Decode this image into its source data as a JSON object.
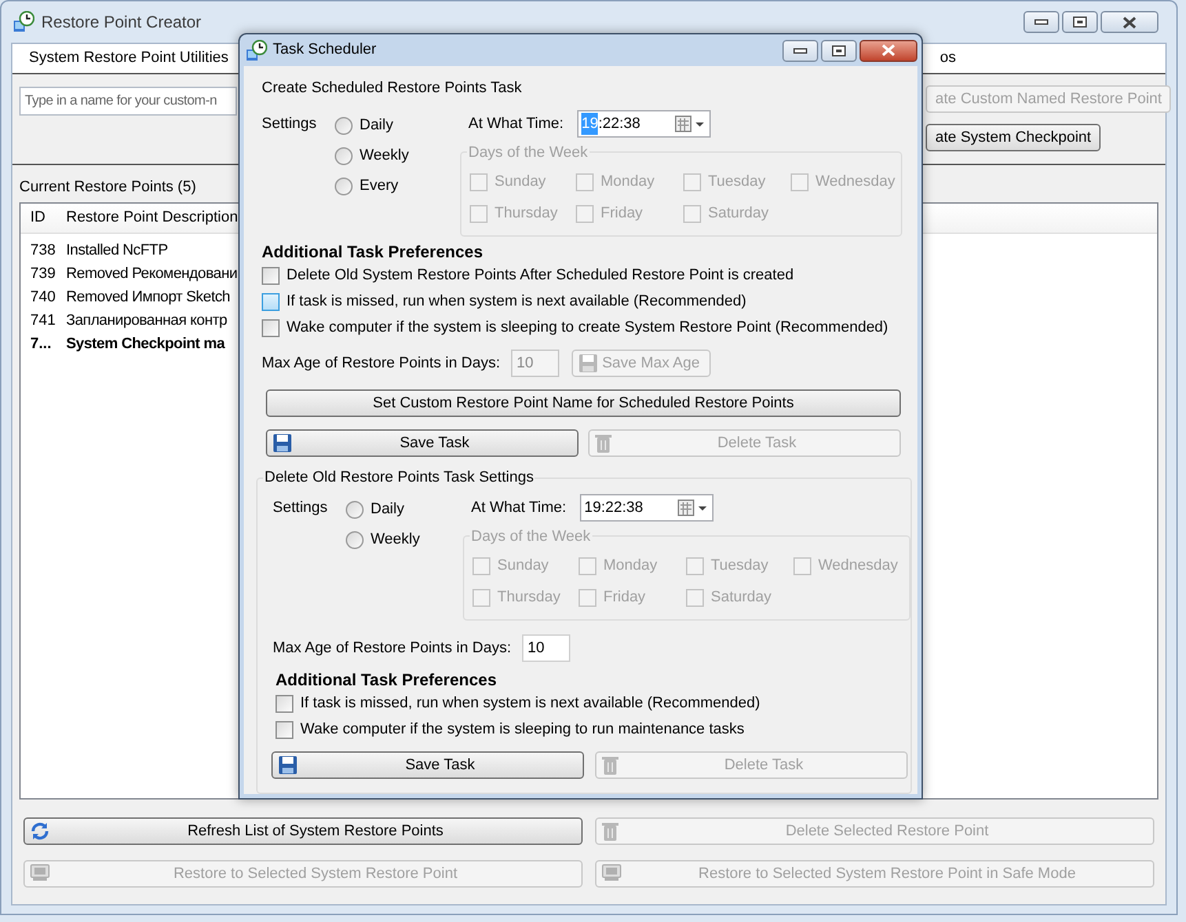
{
  "main_window": {
    "title": "Restore Point Creator",
    "menu": [
      {
        "label": "System Restore Point Utilities"
      },
      {
        "label": "os"
      }
    ],
    "name_field": {
      "placeholder": "Type in a name for your custom-n"
    },
    "right_buttons": [
      {
        "label": "ate Custom Named Restore Point",
        "disabled": true
      },
      {
        "label": "ate System Checkpoint",
        "disabled": false
      }
    ],
    "restore_points": {
      "title": "Current Restore Points (5)",
      "columns": [
        "ID",
        "Restore Point Description"
      ],
      "rows": [
        {
          "id": "738",
          "description": "Installed NcFTP",
          "emphasized": false
        },
        {
          "id": "739",
          "description": "Removed Рекомендовани",
          "emphasized": false
        },
        {
          "id": "740",
          "description": "Removed Импорт Sketch",
          "emphasized": false
        },
        {
          "id": "741",
          "description": "Запланированная контр",
          "emphasized": false
        },
        {
          "id": "7...",
          "description": "System Checkpoint ma",
          "emphasized": true
        }
      ]
    },
    "bottom_buttons": [
      {
        "label": "Refresh List of System Restore Points",
        "kind": "refresh",
        "disabled": false
      },
      {
        "label": "Delete Selected Restore Point",
        "kind": "trash",
        "disabled": true
      },
      {
        "label": "Restore to Selected System Restore Point",
        "kind": "drive",
        "disabled": true
      },
      {
        "label": "Restore to Selected System Restore Point in Safe Mode",
        "kind": "drive",
        "disabled": true
      }
    ]
  },
  "dialog": {
    "title": "Task Scheduler",
    "schedule": {
      "heading": "Create Scheduled Restore Points Task",
      "settings_label": "Settings",
      "options": [
        {
          "label": "Daily",
          "selected": false
        },
        {
          "label": "Weekly",
          "selected": false
        },
        {
          "label": "Every",
          "selected": false
        }
      ],
      "time_label": "At What Time:",
      "time_selected_part": "19",
      "time_rest": ":22:38",
      "days_title": "Days of the Week",
      "days": [
        {
          "label": "Sunday",
          "checked": false,
          "disabled": true
        },
        {
          "label": "Monday",
          "checked": false,
          "disabled": true
        },
        {
          "label": "Tuesday",
          "checked": false,
          "disabled": true
        },
        {
          "label": "Wednesday",
          "checked": false,
          "disabled": true
        },
        {
          "label": "Thursday",
          "checked": false,
          "disabled": true
        },
        {
          "label": "Friday",
          "checked": false,
          "disabled": true
        },
        {
          "label": "Saturday",
          "checked": false,
          "disabled": true
        }
      ],
      "prefs_title": "Additional Task Preferences",
      "prefs": [
        {
          "label": "Delete Old System Restore Points After Scheduled Restore Point is created",
          "checked": false,
          "hovered": false
        },
        {
          "label": "If task is missed, run when system is next available (Recommended)",
          "checked": false,
          "hovered": true
        },
        {
          "label": "Wake computer if the system is sleeping to create System Restore Point (Recommended)",
          "checked": false,
          "hovered": false
        }
      ],
      "max_age_label": "Max Age of Restore Points in Days:",
      "max_age_value": "10",
      "max_age_disabled": true,
      "save_max_age": {
        "label": "Save Max Age",
        "kind": "floppy",
        "disabled": true
      },
      "custom_name_button": {
        "label": "Set Custom Restore Point Name for Scheduled Restore Points",
        "disabled": false
      },
      "actions": [
        {
          "label": "Save Task",
          "kind": "floppy",
          "disabled": false
        },
        {
          "label": "Delete Task",
          "kind": "trash",
          "disabled": true
        }
      ]
    },
    "cleanup": {
      "heading": "Delete Old Restore Points Task Settings",
      "settings_label": "Settings",
      "options": [
        {
          "label": "Daily",
          "selected": false
        },
        {
          "label": "Weekly",
          "selected": false
        }
      ],
      "time_label": "At What Time:",
      "time_value": "19:22:38",
      "days_title": "Days of the Week",
      "days": [
        {
          "label": "Sunday",
          "checked": false,
          "disabled": true
        },
        {
          "label": "Monday",
          "checked": false,
          "disabled": true
        },
        {
          "label": "Tuesday",
          "checked": false,
          "disabled": true
        },
        {
          "label": "Wednesday",
          "checked": false,
          "disabled": true
        },
        {
          "label": "Thursday",
          "checked": false,
          "disabled": true
        },
        {
          "label": "Friday",
          "checked": false,
          "disabled": true
        },
        {
          "label": "Saturday",
          "checked": false,
          "disabled": true
        }
      ],
      "max_age_label": "Max Age of Restore Points in Days:",
      "max_age_value": "10",
      "max_age_disabled": false,
      "prefs_title": "Additional Task Preferences",
      "prefs": [
        {
          "label": "If task is missed, run when system is next available (Recommended)",
          "checked": false,
          "hovered": false
        },
        {
          "label": "Wake computer if the system is sleeping to run maintenance tasks",
          "checked": false,
          "hovered": false
        }
      ],
      "actions": [
        {
          "label": "Save Task",
          "kind": "floppy",
          "disabled": false
        },
        {
          "label": "Delete Task",
          "kind": "trash",
          "disabled": true
        }
      ]
    }
  }
}
